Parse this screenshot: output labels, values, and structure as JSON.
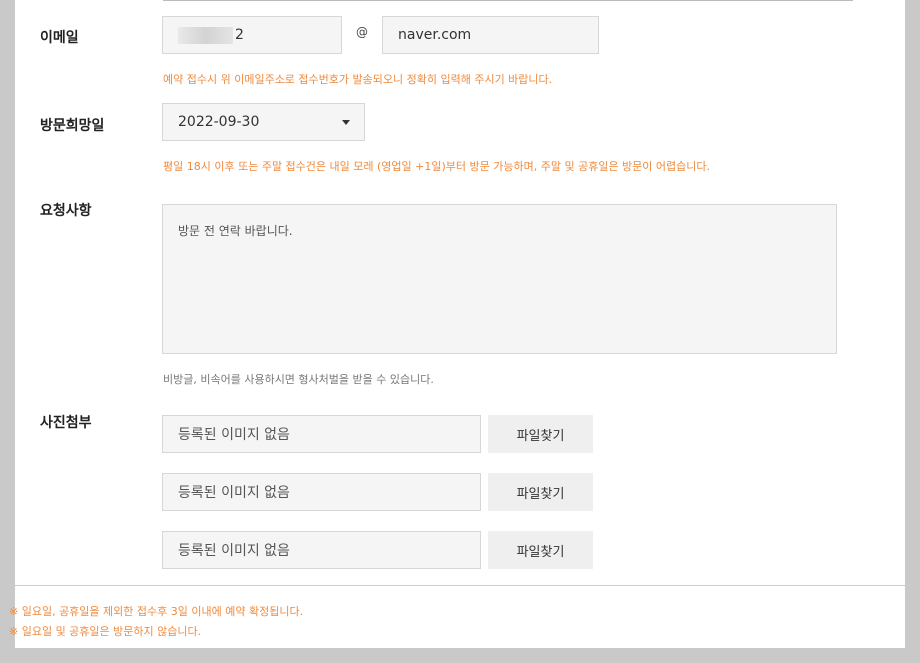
{
  "email": {
    "label": "이메일",
    "local_visible": "2",
    "at": "@",
    "domain": "naver.com",
    "hint": "예약 접수시 위 이메일주소로 접수번호가 발송되오니 정확히 입력해 주시기 바랍니다."
  },
  "visit_date": {
    "label": "방문희망일",
    "selected": "2022-09-30",
    "hint": "평일 18시 이후 또는 주말 접수건은 내일 모레 (영업일 +1일)부터 방문 가능하며, 주말 및 공휴일은 방문이 어렵습니다."
  },
  "request": {
    "label": "요청사항",
    "text": "방문 전 연락 바랍니다.",
    "hint": "비방글, 비속어를 사용하시면 형사처벌을 받을 수 있습니다."
  },
  "photo": {
    "label": "사진첨부",
    "slots": [
      {
        "placeholder": "등록된 이미지 없음",
        "button": "파일찾기"
      },
      {
        "placeholder": "등록된 이미지 없음",
        "button": "파일찾기"
      },
      {
        "placeholder": "등록된 이미지 없음",
        "button": "파일찾기"
      }
    ]
  },
  "notes": [
    "※ 일요일, 공휴일을 제외한 접수후 3일 이내에 예약 확정됩니다.",
    "※ 일요일 및 공휴일은 방문하지 않습니다."
  ],
  "colors": {
    "accent": "#f08a3c",
    "field_bg": "#f5f5f5",
    "page_bg": "#c9c9c9"
  }
}
